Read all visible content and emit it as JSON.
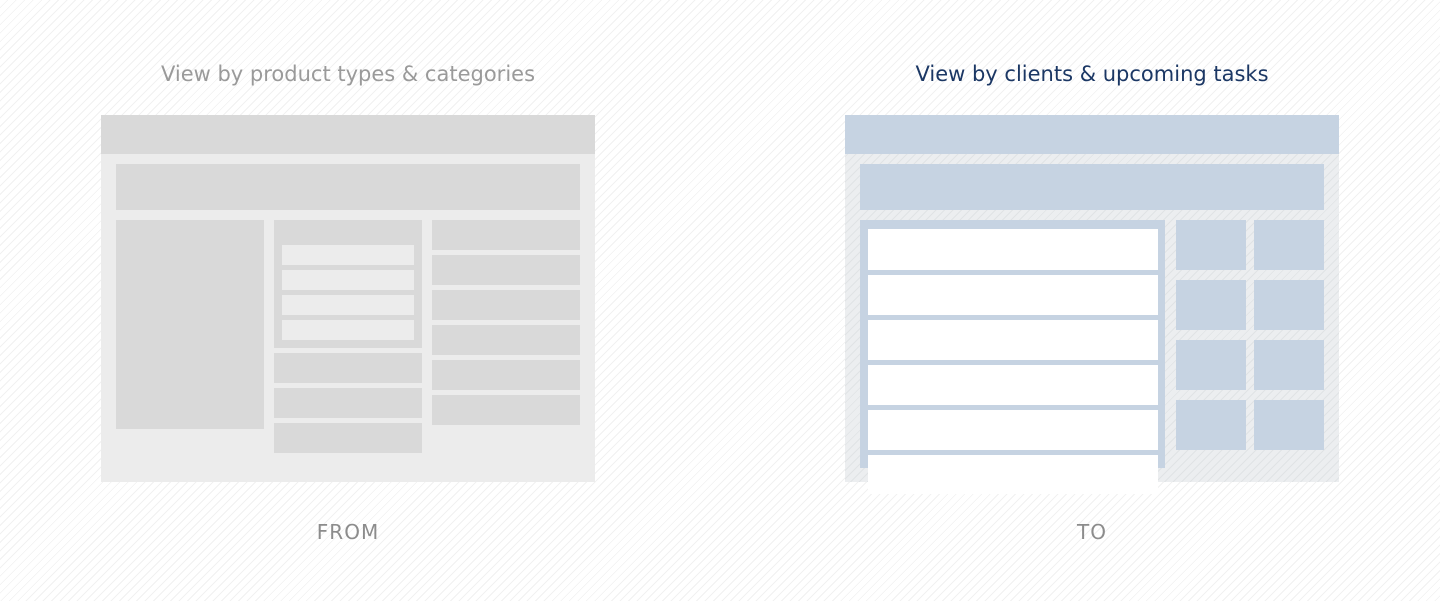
{
  "from_panel": {
    "title": "View by product types & categories",
    "caption": "FROM",
    "color": "#999999"
  },
  "to_panel": {
    "title": "View by clients & upcoming tasks",
    "caption": "TO",
    "color": "#1b3764",
    "accent": "#c6d3e2"
  }
}
